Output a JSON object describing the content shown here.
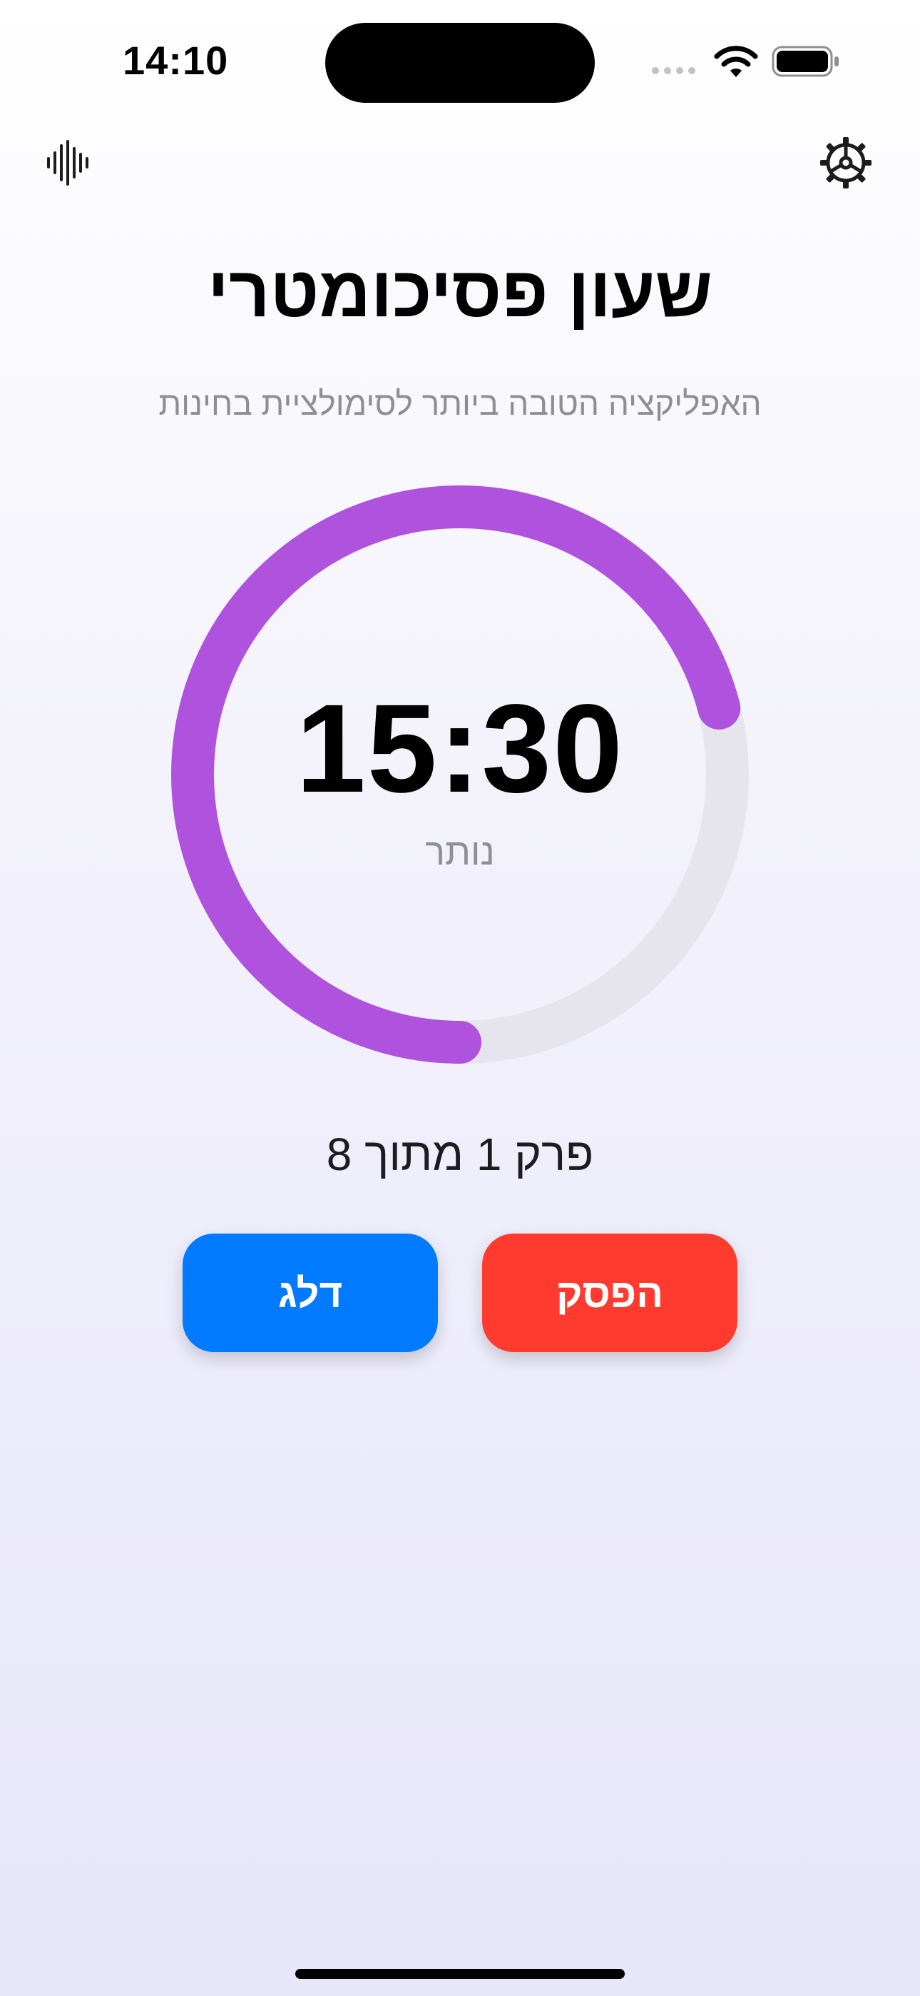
{
  "status_bar": {
    "time": "14:10"
  },
  "header": {
    "left_icon": "waveform-icon",
    "right_icon": "gear-icon"
  },
  "title": "שעון פסיכומטרי",
  "subtitle": "האפליקציה הטובה ביותר לסימולציית בחינות",
  "timer": {
    "value": "15:30",
    "label": "נותר",
    "remaining_fraction": 0.71,
    "progress_color": "#af52de",
    "track_color": "#e6e5ee"
  },
  "section_progress": "פרק 1 מתוך 8",
  "buttons": {
    "skip_label": "דלג",
    "stop_label": "הפסק",
    "skip_color": "#007aff",
    "stop_color": "#ff3b30"
  }
}
